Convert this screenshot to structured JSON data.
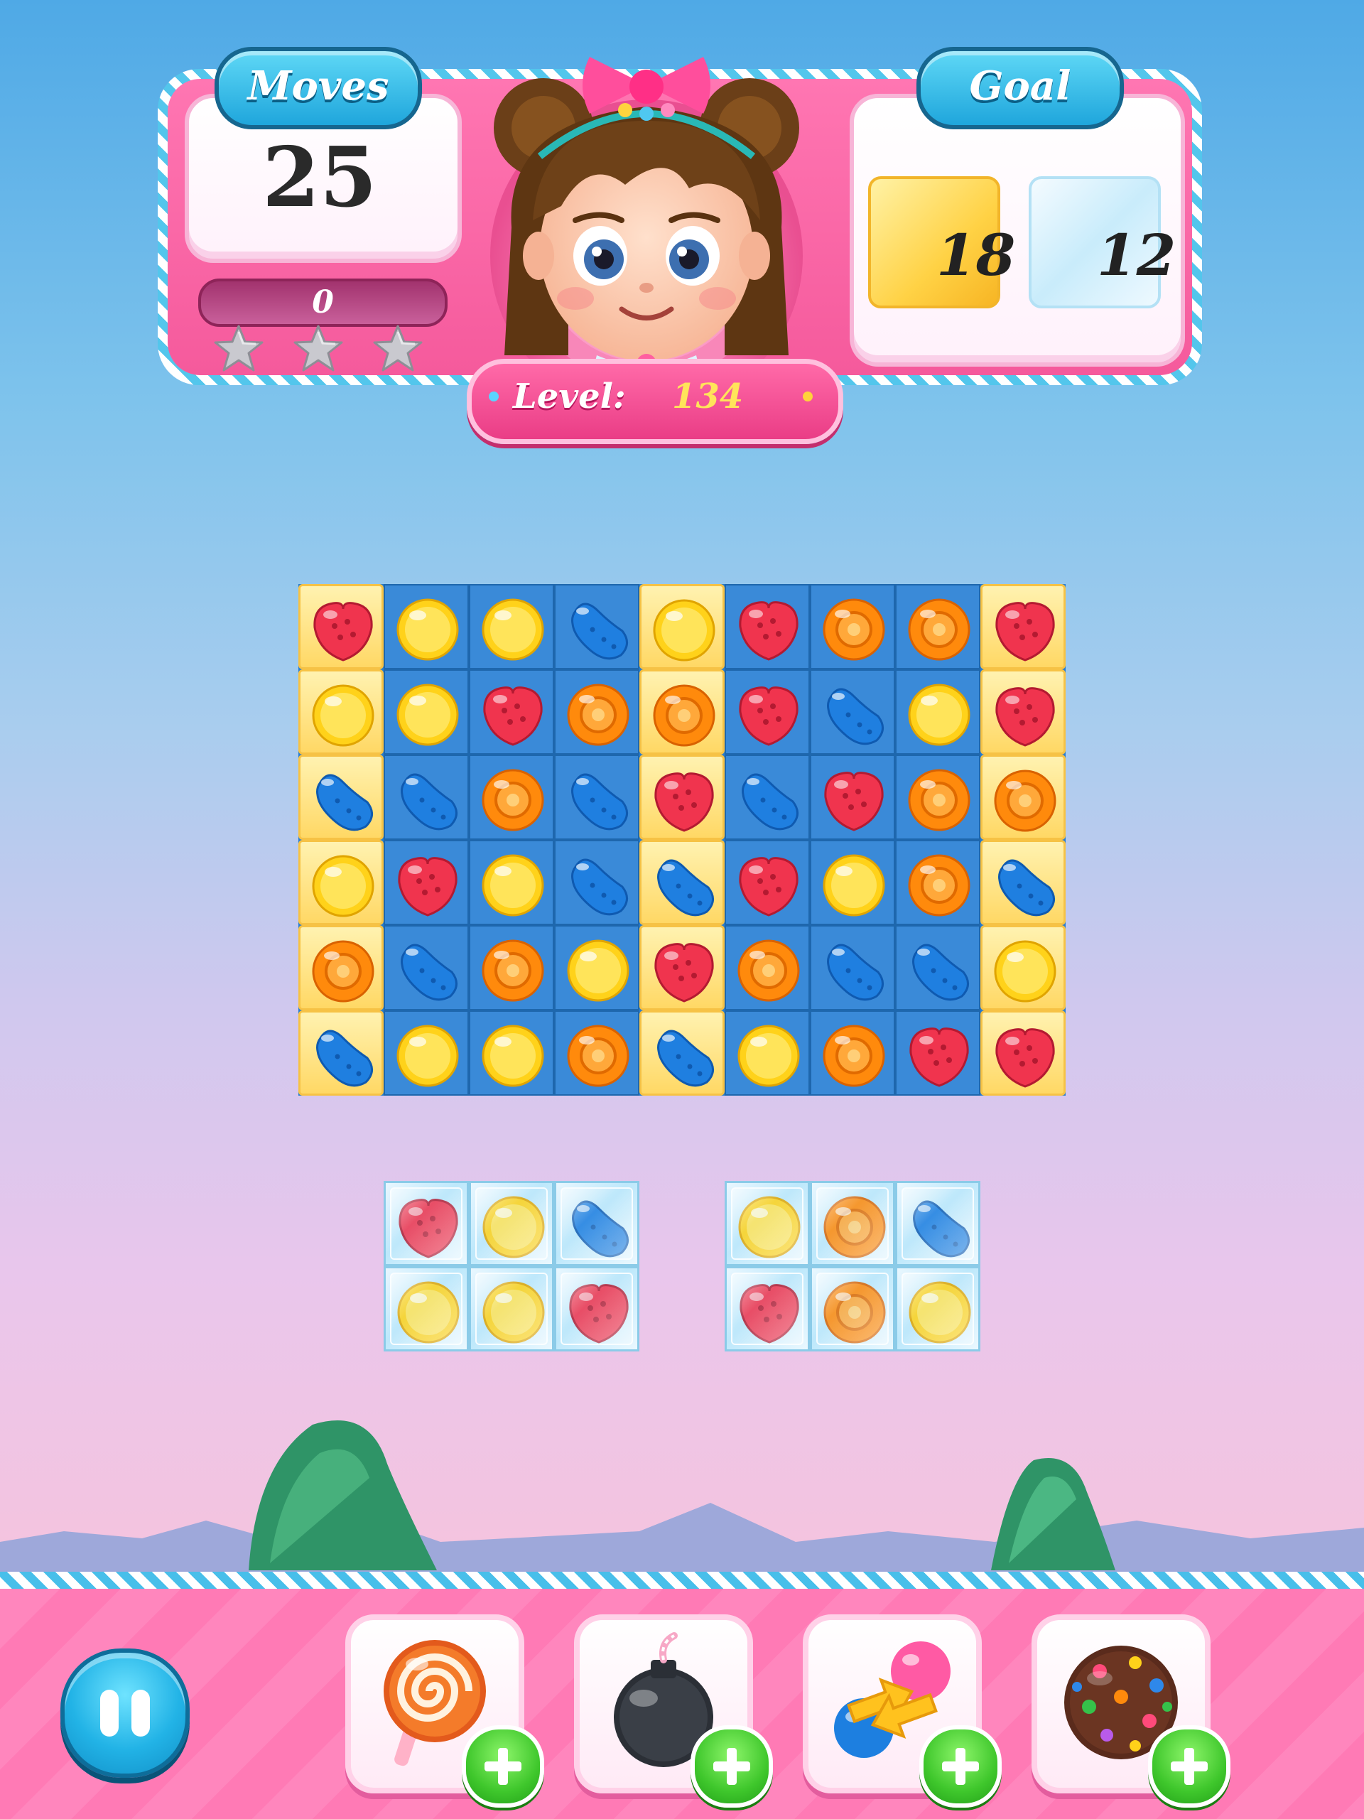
{
  "hud": {
    "moves_label": "Moves",
    "moves_value": "25",
    "score_value": "0",
    "stars_earned": 0,
    "stars_total": 3,
    "goal_label": "Goal",
    "goals": [
      {
        "type": "jelly",
        "count": "18"
      },
      {
        "type": "ice",
        "count": "12"
      }
    ],
    "level_label": "Level:",
    "level_value": "134"
  },
  "board": {
    "rows": [
      [
        "red",
        "yellow",
        "yellow",
        "blue",
        "yellow",
        "red",
        "orange",
        "orange",
        "red"
      ],
      [
        "yellow",
        "yellow",
        "red",
        "orange",
        "orange",
        "red",
        "blue",
        "yellow",
        "red"
      ],
      [
        "blue",
        "blue",
        "orange",
        "blue",
        "red",
        "blue",
        "red",
        "orange",
        "orange"
      ],
      [
        "yellow",
        "red",
        "yellow",
        "blue",
        "blue",
        "red",
        "yellow",
        "orange",
        "blue"
      ],
      [
        "orange",
        "blue",
        "orange",
        "yellow",
        "red",
        "orange",
        "blue",
        "blue",
        "yellow"
      ],
      [
        "blue",
        "yellow",
        "yellow",
        "orange",
        "blue",
        "yellow",
        "orange",
        "red",
        "red"
      ]
    ],
    "jelly": [
      [
        true,
        false,
        false,
        false,
        true,
        false,
        false,
        false,
        true
      ],
      [
        true,
        false,
        false,
        false,
        true,
        false,
        false,
        false,
        true
      ],
      [
        true,
        false,
        false,
        false,
        true,
        false,
        false,
        false,
        true
      ],
      [
        true,
        false,
        false,
        false,
        true,
        false,
        false,
        false,
        true
      ],
      [
        true,
        false,
        false,
        false,
        true,
        false,
        false,
        false,
        true
      ],
      [
        true,
        false,
        false,
        false,
        true,
        false,
        false,
        false,
        true
      ]
    ]
  },
  "ice_boards": [
    {
      "rows": [
        [
          "red",
          "yellow",
          "blue"
        ],
        [
          "yellow",
          "yellow",
          "red"
        ]
      ]
    },
    {
      "rows": [
        [
          "yellow",
          "orange",
          "blue"
        ],
        [
          "red",
          "orange",
          "yellow"
        ]
      ]
    }
  ],
  "boosters": [
    {
      "name": "lollipop-hammer"
    },
    {
      "name": "bomb"
    },
    {
      "name": "swap"
    },
    {
      "name": "color-bomb"
    }
  ],
  "colors": {
    "red": "#f0344e",
    "yellow": "#ffd21a",
    "orange": "#ff8a0c",
    "blue": "#1f7fe0"
  }
}
